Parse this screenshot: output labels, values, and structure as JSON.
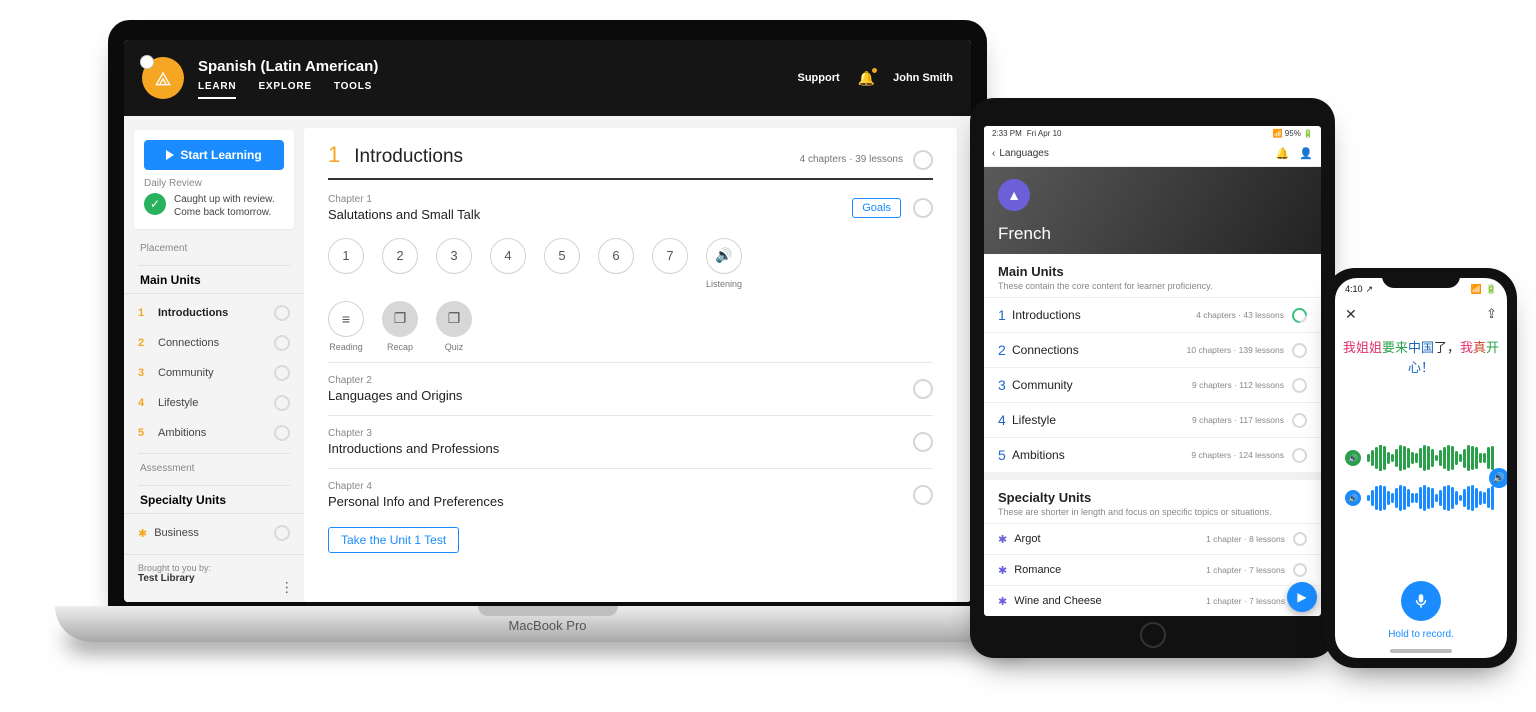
{
  "laptop": {
    "brand": "MacBook Pro",
    "course_title": "Spanish (Latin American)",
    "tabs": [
      "LEARN",
      "EXPLORE",
      "TOOLS"
    ],
    "support": "Support",
    "user_name": "John Smith",
    "start_button": "Start Learning",
    "daily_review_label": "Daily Review",
    "daily_review_text": "Caught up with review. Come back tomorrow.",
    "placement_label": "Placement",
    "main_units_heading": "Main Units",
    "main_units": [
      {
        "n": "1",
        "name": "Introductions"
      },
      {
        "n": "2",
        "name": "Connections"
      },
      {
        "n": "3",
        "name": "Community"
      },
      {
        "n": "4",
        "name": "Lifestyle"
      },
      {
        "n": "5",
        "name": "Ambitions"
      }
    ],
    "assessment_label": "Assessment",
    "specialty_heading": "Specialty Units",
    "specialty_item": "Business",
    "footer_brought": "Brought to you by:",
    "footer_lib": "Test Library",
    "unit_number": "1",
    "unit_name": "Introductions",
    "unit_meta": "4 chapters · 39 lessons",
    "chapter1_label": "Chapter 1",
    "chapter1_name": "Salutations and Small Talk",
    "goals": "Goals",
    "lesson_numbers": [
      "1",
      "2",
      "3",
      "4",
      "5",
      "6",
      "7"
    ],
    "listening_caption": "Listening",
    "activities": [
      {
        "name": "Reading",
        "glyph": "≡",
        "dark": false
      },
      {
        "name": "Recap",
        "glyph": "❐",
        "dark": true
      },
      {
        "name": "Quiz",
        "glyph": "❐",
        "dark": true
      }
    ],
    "chapter2_label": "Chapter 2",
    "chapter2_name": "Languages and Origins",
    "chapter3_label": "Chapter 3",
    "chapter3_name": "Introductions and Professions",
    "chapter4_label": "Chapter 4",
    "chapter4_name": "Personal Info and Preferences",
    "unit_test": "Take the Unit 1 Test"
  },
  "tablet": {
    "status_time": "2:33 PM",
    "status_date": "Fri Apr 10",
    "status_battery": "95%",
    "back_label": "Languages",
    "hero_title": "French",
    "main_heading": "Main Units",
    "main_sub": "These contain the core content for learner proficiency.",
    "units": [
      {
        "n": "1",
        "name": "Introductions",
        "meta": "4 chapters · 43 lessons"
      },
      {
        "n": "2",
        "name": "Connections",
        "meta": "10 chapters · 139 lessons"
      },
      {
        "n": "3",
        "name": "Community",
        "meta": "9 chapters · 112 lessons"
      },
      {
        "n": "4",
        "name": "Lifestyle",
        "meta": "9 chapters · 117 lessons"
      },
      {
        "n": "5",
        "name": "Ambitions",
        "meta": "9 chapters · 124 lessons"
      }
    ],
    "spec_heading": "Specialty Units",
    "spec_sub": "These are shorter in length and focus on specific topics or situations.",
    "spec_items": [
      {
        "name": "Argot",
        "meta": "1 chapter · 8 lessons"
      },
      {
        "name": "Romance",
        "meta": "1 chapter · 7 lessons"
      },
      {
        "name": "Wine and Cheese",
        "meta": "1 chapter · 7 lessons"
      }
    ]
  },
  "phone": {
    "time": "4:10",
    "sentence_parts": [
      {
        "t": "我",
        "c": "c1"
      },
      {
        "t": "姐姐",
        "c": "c1"
      },
      {
        "t": "要",
        "c": "c2"
      },
      {
        "t": "来",
        "c": "c2"
      },
      {
        "t": "中国",
        "c": "c3"
      },
      {
        "t": "了，",
        "c": "c5"
      },
      {
        "t": "我",
        "c": "c1"
      },
      {
        "t": "真",
        "c": "c4"
      },
      {
        "t": "开",
        "c": "c2"
      },
      {
        "t": "心！",
        "c": "c3"
      }
    ],
    "record_label": "Hold to record."
  }
}
